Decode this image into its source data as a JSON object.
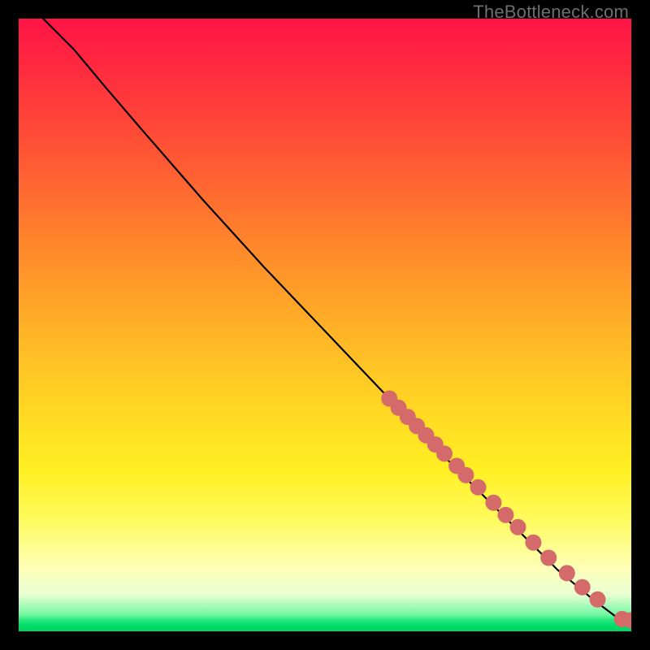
{
  "watermark": "TheBottleneck.com",
  "chart_data": {
    "type": "line",
    "title": "",
    "xlabel": "",
    "ylabel": "",
    "xlim": [
      0,
      100
    ],
    "ylim": [
      0,
      100
    ],
    "gradient_stops": [
      {
        "pos": 0,
        "color": "#ff1446"
      },
      {
        "pos": 8,
        "color": "#ff2a3f"
      },
      {
        "pos": 22,
        "color": "#ff5534"
      },
      {
        "pos": 38,
        "color": "#ff8a2a"
      },
      {
        "pos": 52,
        "color": "#ffb626"
      },
      {
        "pos": 64,
        "color": "#ffd823"
      },
      {
        "pos": 74,
        "color": "#fff023"
      },
      {
        "pos": 82,
        "color": "#fffb60"
      },
      {
        "pos": 90,
        "color": "#fdffba"
      },
      {
        "pos": 94,
        "color": "#e8ffd2"
      },
      {
        "pos": 97.2,
        "color": "#76f7a4"
      },
      {
        "pos": 98.4,
        "color": "#17e57a"
      },
      {
        "pos": 99.2,
        "color": "#00d968"
      },
      {
        "pos": 100,
        "color": "#00d465"
      }
    ],
    "curve": [
      {
        "x": 4,
        "y": 100
      },
      {
        "x": 9,
        "y": 95
      },
      {
        "x": 14,
        "y": 89
      },
      {
        "x": 20,
        "y": 82
      },
      {
        "x": 30,
        "y": 70.5
      },
      {
        "x": 40,
        "y": 59.5
      },
      {
        "x": 50,
        "y": 49
      },
      {
        "x": 60,
        "y": 38.5
      },
      {
        "x": 70,
        "y": 28
      },
      {
        "x": 80,
        "y": 18
      },
      {
        "x": 88,
        "y": 10
      },
      {
        "x": 94,
        "y": 5
      },
      {
        "x": 98,
        "y": 2
      },
      {
        "x": 100,
        "y": 1.8
      }
    ],
    "dots": [
      {
        "x": 60.5,
        "y": 38.0
      },
      {
        "x": 62.0,
        "y": 36.5
      },
      {
        "x": 63.5,
        "y": 35.0
      },
      {
        "x": 65.0,
        "y": 33.5
      },
      {
        "x": 66.5,
        "y": 32.0
      },
      {
        "x": 68.0,
        "y": 30.5
      },
      {
        "x": 69.5,
        "y": 29.0
      },
      {
        "x": 71.5,
        "y": 27.0
      },
      {
        "x": 73.0,
        "y": 25.5
      },
      {
        "x": 75.0,
        "y": 23.5
      },
      {
        "x": 77.5,
        "y": 21.0
      },
      {
        "x": 79.5,
        "y": 19.0
      },
      {
        "x": 81.5,
        "y": 17.0
      },
      {
        "x": 84.0,
        "y": 14.5
      },
      {
        "x": 86.5,
        "y": 12.0
      },
      {
        "x": 89.5,
        "y": 9.5
      },
      {
        "x": 92.0,
        "y": 7.2
      },
      {
        "x": 94.5,
        "y": 5.2
      },
      {
        "x": 98.5,
        "y": 2.0
      },
      {
        "x": 100.0,
        "y": 1.8
      }
    ],
    "dot_color": "#d46a6a",
    "dot_radius_px": 10,
    "curve_color": "#000000"
  }
}
